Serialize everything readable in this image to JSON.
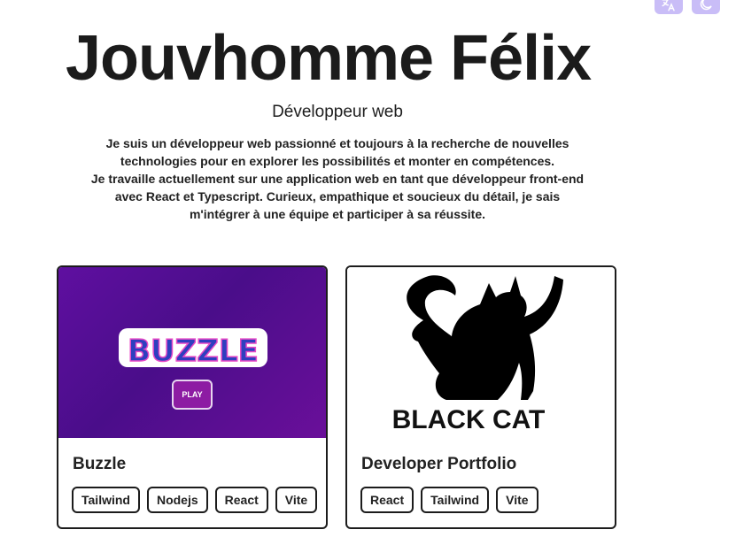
{
  "header": {
    "icons": [
      {
        "name": "translate-icon"
      },
      {
        "name": "dark-mode-icon"
      }
    ],
    "title": "Jouvhomme Félix",
    "subtitle": "Développeur web",
    "bio_lines": [
      "Je suis un développeur web passionné et toujours à la recherche de nouvelles",
      "technologies pour en explorer les possibilités et monter en compétences.",
      "Je travaille actuellement sur une application web en tant que développeur front-end",
      "avec React et Typescript. Curieux, empathique et soucieux du détail, je sais",
      "m'intégrer à une équipe et participer à sa réussite."
    ]
  },
  "projects": [
    {
      "title": "Buzzle",
      "image": {
        "logo_text": "BUZZLE",
        "button_label": "PLAY"
      },
      "tags": [
        "Tailwind",
        "Nodejs",
        "React",
        "Vite"
      ]
    },
    {
      "title": "Developer Portfolio",
      "image": {
        "logo_text": "BLACK CAT"
      },
      "tags": [
        "React",
        "Tailwind",
        "Vite"
      ]
    }
  ],
  "colors": {
    "accent_icon_bg": "#c9bdf7",
    "buzzle_purple": "#5f0fa0",
    "text": "#1d1d1d"
  }
}
